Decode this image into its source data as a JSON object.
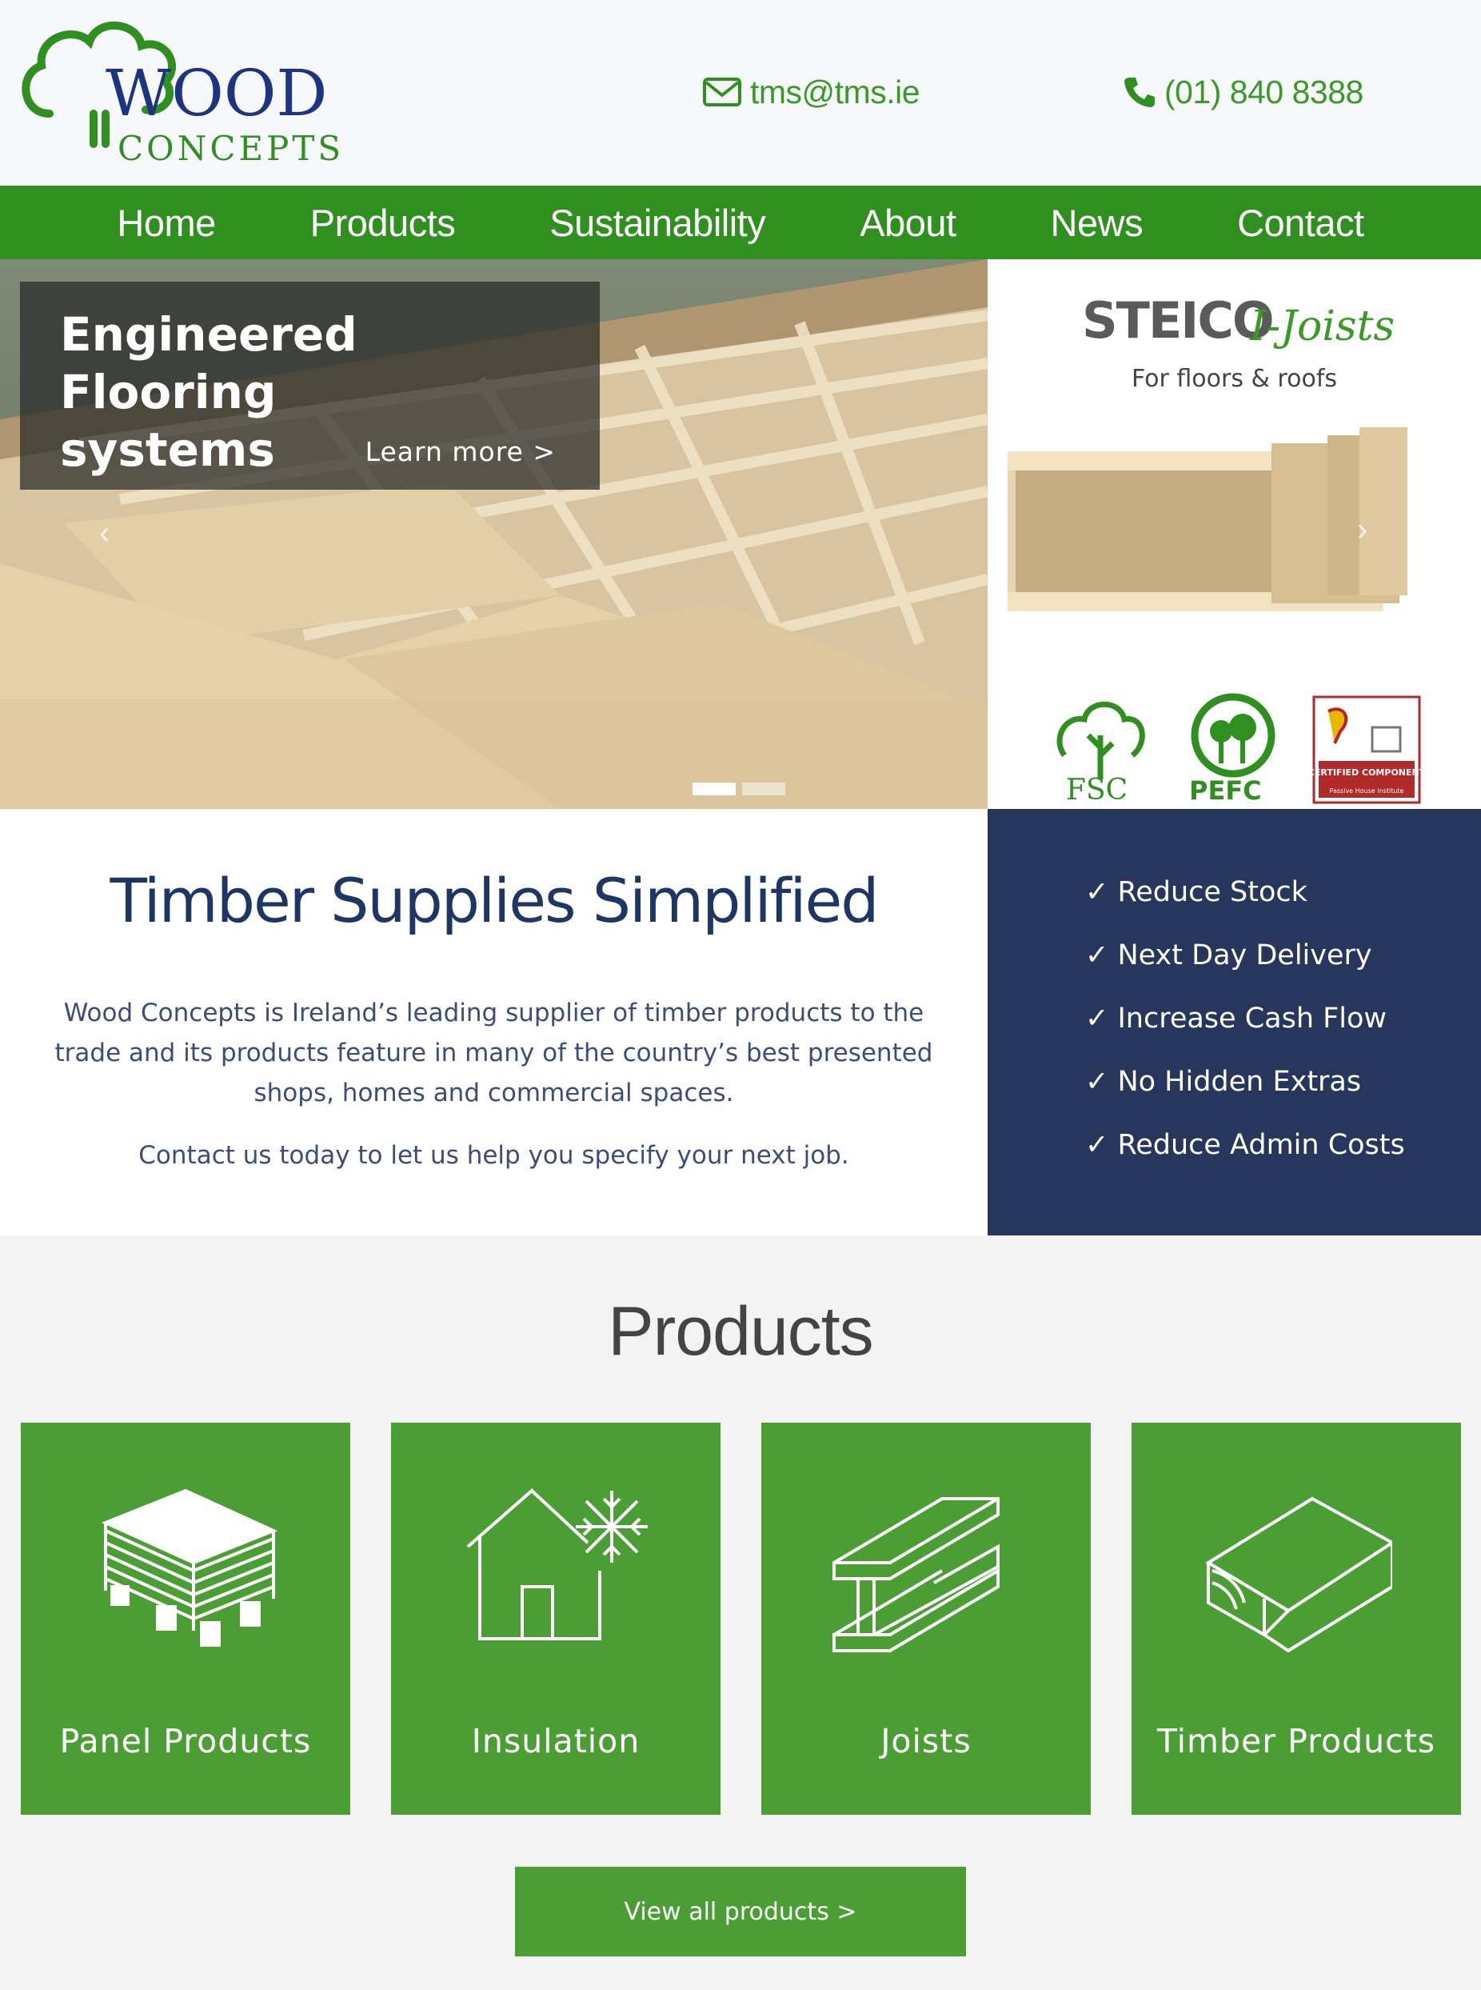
{
  "header": {
    "email": "tms@tms.ie",
    "phone": "(01) 840 8388",
    "logo_word1": "WOOD",
    "logo_word2": "CONCEPTS"
  },
  "nav": [
    "Home",
    "Products",
    "Sustainability",
    "About",
    "News",
    "Contact"
  ],
  "hero": {
    "title_line1": "Engineered Flooring",
    "title_line2": "systems",
    "link": "Learn more >"
  },
  "promo": {
    "brand": "STEICO",
    "product": "I-Joists",
    "subtitle": "For floors & roofs",
    "cert_fsc": "FSC",
    "cert_pefc": "PEFC",
    "cert_passive": "CERTIFIED COMPONENT",
    "cert_passive_small": "Passive House Institute"
  },
  "intro": {
    "title": "Timber Supplies Simplified",
    "para1": "Wood Concepts is Ireland’s leading supplier of timber products to the trade and its products feature in many of the country’s best presented shops, homes and commercial spaces.",
    "para2": "Contact us today to let us help you specify your next job."
  },
  "benefits": [
    "✓ Reduce Stock",
    "✓ Next Day Delivery",
    "✓ Increase Cash Flow",
    "✓ No Hidden Extras",
    "✓ Reduce Admin Costs"
  ],
  "products": {
    "title": "Products",
    "cards": [
      {
        "label": "Panel Products",
        "icon": "panel-stack-icon"
      },
      {
        "label": "Insulation",
        "icon": "house-snowflake-icon"
      },
      {
        "label": "Joists",
        "icon": "i-beam-icon"
      },
      {
        "label": "Timber Products",
        "icon": "timber-block-icon"
      }
    ],
    "view_all": "View all products >"
  },
  "colors": {
    "green": "#2f8f1f",
    "card_green": "#4a9e34",
    "navy": "#26365d"
  }
}
